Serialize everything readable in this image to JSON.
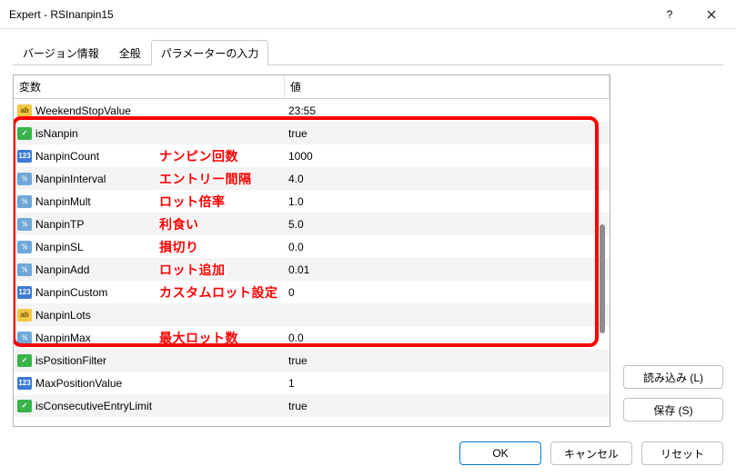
{
  "window": {
    "title": "Expert - RSInanpin15"
  },
  "tabs": {
    "t0": "バージョン情報",
    "t1": "全般",
    "t2": "パラメーターの入力"
  },
  "columns": {
    "var": "変数",
    "val": "値"
  },
  "rows": [
    {
      "icon": "ab",
      "name": "WeekendStopValue",
      "value": "23:55",
      "annot": ""
    },
    {
      "icon": "bool",
      "name": "isNanpin",
      "value": "true",
      "annot": ""
    },
    {
      "icon": "123",
      "name": "NanpinCount",
      "value": "1000",
      "annot": "ナンピン回数"
    },
    {
      "icon": "vz",
      "name": "NanpinInterval",
      "value": "4.0",
      "annot": "エントリー間隔"
    },
    {
      "icon": "vz",
      "name": "NanpinMult",
      "value": "1.0",
      "annot": "ロット倍率"
    },
    {
      "icon": "vz",
      "name": "NanpinTP",
      "value": "5.0",
      "annot": "利食い"
    },
    {
      "icon": "vz",
      "name": "NanpinSL",
      "value": "0.0",
      "annot": "損切り"
    },
    {
      "icon": "vz",
      "name": "NanpinAdd",
      "value": "0.01",
      "annot": "ロット追加"
    },
    {
      "icon": "123",
      "name": "NanpinCustom",
      "value": "0",
      "annot": "カスタムロット設定"
    },
    {
      "icon": "ab",
      "name": "NanpinLots",
      "value": "",
      "annot": ""
    },
    {
      "icon": "vz",
      "name": "NanpinMax",
      "value": "0.0",
      "annot": "最大ロット数"
    },
    {
      "icon": "bool",
      "name": "isPositionFilter",
      "value": "true",
      "annot": ""
    },
    {
      "icon": "123",
      "name": "MaxPositionValue",
      "value": "1",
      "annot": ""
    },
    {
      "icon": "bool",
      "name": "isConsecutiveEntryLimit",
      "value": "true",
      "annot": ""
    }
  ],
  "side_buttons": {
    "load": "読み込み (L)",
    "save": "保存 (S)"
  },
  "footer": {
    "ok": "OK",
    "cancel": "キャンセル",
    "reset": "リセット"
  },
  "highlight": {
    "row_start": 1,
    "row_end": 10
  },
  "icon_text": {
    "ab": "ab",
    "bool": "✓",
    "123": "123",
    "vz": "½"
  }
}
